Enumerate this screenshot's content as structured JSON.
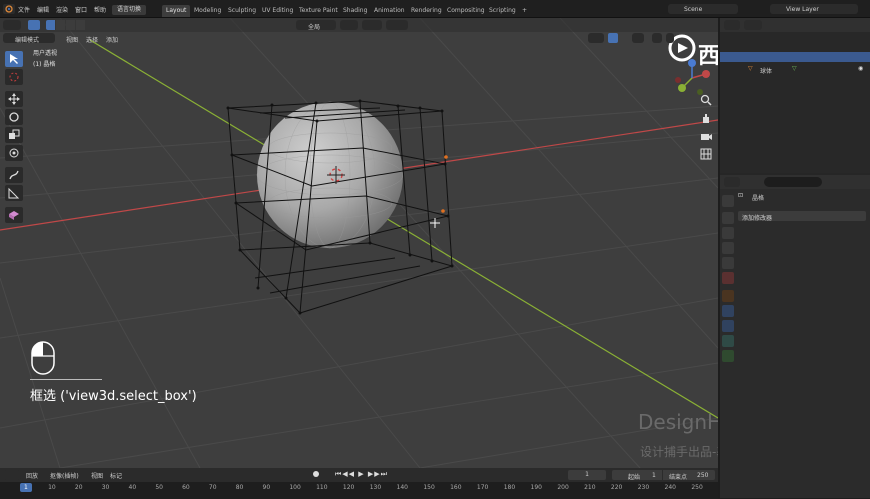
{
  "topbar": {
    "menus": [
      "文件",
      "编辑",
      "渲染",
      "窗口",
      "帮助"
    ],
    "lang_toggle": "语言切换",
    "workspaces": [
      "Layout",
      "Modeling",
      "Sculpting",
      "UV Editing",
      "Texture Paint",
      "Shading",
      "Animation",
      "Rendering",
      "Compositing",
      "Scripting"
    ],
    "add_workspace": "+",
    "scene": "Scene",
    "view_layer": "View Layer"
  },
  "viewport": {
    "mode": "编辑模式",
    "menus": [
      "视图",
      "选择",
      "添加"
    ],
    "transform_orientation": "全局",
    "overlay_title": "用户透视",
    "overlay_object": "(1) 晶格"
  },
  "watermark": {
    "logo_text": "西瓜视频",
    "brand": "DesignHunting",
    "subtitle": "设计捕手出品-基础部分"
  },
  "operator": {
    "label": "框选 ('view3d.select_box')"
  },
  "outliner": {
    "items": [
      "球体"
    ]
  },
  "properties": {
    "object_name": "晶格",
    "add_modifier": "添加修改器"
  },
  "timeline": {
    "menus": [
      "回放",
      "抠像(插帧)",
      "视图",
      "标记"
    ],
    "current_frame": "1",
    "start_label": "起始",
    "start_value": "1",
    "end_label": "结束点",
    "end_value": "250",
    "ticks": [
      "1",
      "10",
      "20",
      "30",
      "40",
      "50",
      "60",
      "70",
      "80",
      "90",
      "100",
      "110",
      "120",
      "130",
      "140",
      "150",
      "160",
      "170",
      "180",
      "190",
      "200",
      "210",
      "220",
      "230",
      "240",
      "250"
    ]
  },
  "colors": {
    "accent": "#4772b3",
    "viewport_bg": "#3e3e3e",
    "axis_x": "#c04848",
    "axis_y": "#8ab035"
  }
}
